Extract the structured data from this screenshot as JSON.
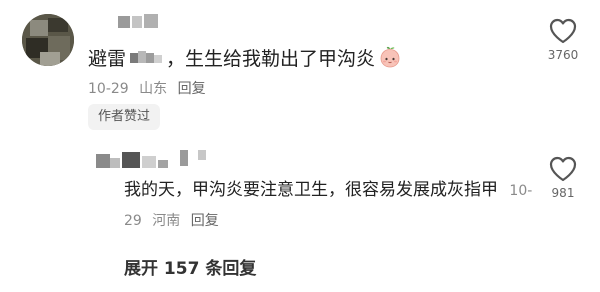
{
  "comment": {
    "text_before": "避雷",
    "text_after": "，生生给我勒出了甲沟炎",
    "emoji_icon": "peach-face-emoji",
    "date": "10-29",
    "location": "山东",
    "reply_label": "回复",
    "author_liked_label": "作者赞过",
    "like_count": "3760"
  },
  "reply": {
    "text": "我的天，甲沟炎要注意卫生，很容易发展成灰指甲",
    "date": "10-29",
    "location": "河南",
    "reply_label": "回复",
    "like_count": "981"
  },
  "expand": {
    "label": "展开 157 条回复"
  },
  "colors": {
    "text_primary": "#222222",
    "text_secondary": "#8a8a8a",
    "chip_bg": "#f2f2f2"
  }
}
